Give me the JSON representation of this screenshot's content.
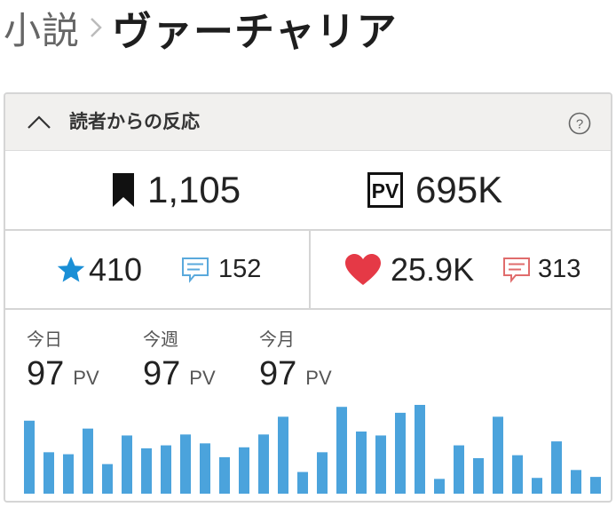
{
  "breadcrumb": {
    "parent": "小説",
    "title": "ヴァーチャリア"
  },
  "panel": {
    "title": "読者からの反応"
  },
  "stats": {
    "bookmarks": "1,105",
    "pv_label": "PV",
    "pv": "695K",
    "stars": "410",
    "reviews": "152",
    "likes": "25.9K",
    "comments": "313"
  },
  "periods": [
    {
      "label": "今日",
      "value": "97",
      "unit": "PV"
    },
    {
      "label": "今週",
      "value": "97",
      "unit": "PV"
    },
    {
      "label": "今月",
      "value": "97",
      "unit": "PV"
    }
  ],
  "colors": {
    "bar": "#4ba3dc",
    "star": "#1a8fd6",
    "review_icon": "#5aa9dc",
    "heart": "#e53946",
    "comment_icon": "#e06c6c"
  },
  "chart_data": {
    "type": "bar",
    "values": [
      74,
      42,
      40,
      66,
      30,
      59,
      46,
      49,
      60,
      51,
      37,
      47,
      60,
      78,
      22,
      42,
      88,
      63,
      59,
      82,
      90,
      15,
      49,
      36,
      78,
      39,
      16,
      53,
      24,
      17
    ],
    "ylim": [
      0,
      90
    ]
  }
}
